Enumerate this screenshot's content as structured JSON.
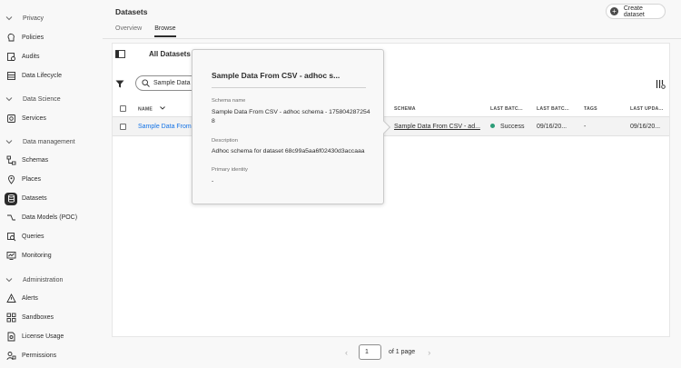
{
  "sidebar": {
    "sections": [
      {
        "label": "Privacy",
        "items": [
          {
            "label": "Policies",
            "icon": "policy-icon"
          },
          {
            "label": "Audits",
            "icon": "audit-icon"
          },
          {
            "label": "Data Lifecycle",
            "icon": "lifecycle-icon"
          }
        ]
      },
      {
        "label": "Data Science",
        "items": [
          {
            "label": "Services",
            "icon": "services-icon"
          }
        ]
      },
      {
        "label": "Data management",
        "items": [
          {
            "label": "Schemas",
            "icon": "schema-icon"
          },
          {
            "label": "Places",
            "icon": "pin-icon"
          },
          {
            "label": "Datasets",
            "icon": "database-icon",
            "active": true
          },
          {
            "label": "Data Models (POC)",
            "icon": "model-icon"
          },
          {
            "label": "Queries",
            "icon": "query-icon"
          },
          {
            "label": "Monitoring",
            "icon": "monitor-icon"
          }
        ]
      },
      {
        "label": "Administration",
        "items": [
          {
            "label": "Alerts",
            "icon": "alert-icon"
          },
          {
            "label": "Sandboxes",
            "icon": "sandbox-icon"
          },
          {
            "label": "License Usage",
            "icon": "license-icon"
          },
          {
            "label": "Permissions",
            "icon": "permissions-icon"
          }
        ]
      }
    ]
  },
  "header": {
    "title": "Datasets",
    "create_label": "Create dataset",
    "tabs": [
      {
        "label": "Overview"
      },
      {
        "label": "Browse",
        "selected": true
      }
    ]
  },
  "browse": {
    "heading": "All Datasets",
    "search_value": "Sample Data",
    "columns": [
      "NAME",
      "SCHEMA",
      "LAST BATC...",
      "LAST BATC...",
      "TAGS",
      "LAST UPDA..."
    ],
    "rows": [
      {
        "name": "Sample Data From (",
        "schema": "Sample Data From CSV - ad...",
        "status": "Success",
        "last_batch_date": "09/16/20...",
        "tags": "-",
        "last_updated": "09/16/20..."
      }
    ]
  },
  "popover": {
    "title": "Sample Data From CSV - adhoc s...",
    "schema_label": "Schema name",
    "schema_value": "Sample Data From CSV - adhoc schema - 1758042872548",
    "description_label": "Description",
    "description_value": "Adhoc schema for dataset 68c99a5aa6f02430d3accaaa",
    "primary_label": "Primary identity",
    "primary_value": "-"
  },
  "pagination": {
    "page": "1",
    "of_label": "of 1 page"
  },
  "colors": {
    "link": "#1473e6",
    "success": "#2d9d78",
    "active_bg": "#2c2c2c"
  }
}
